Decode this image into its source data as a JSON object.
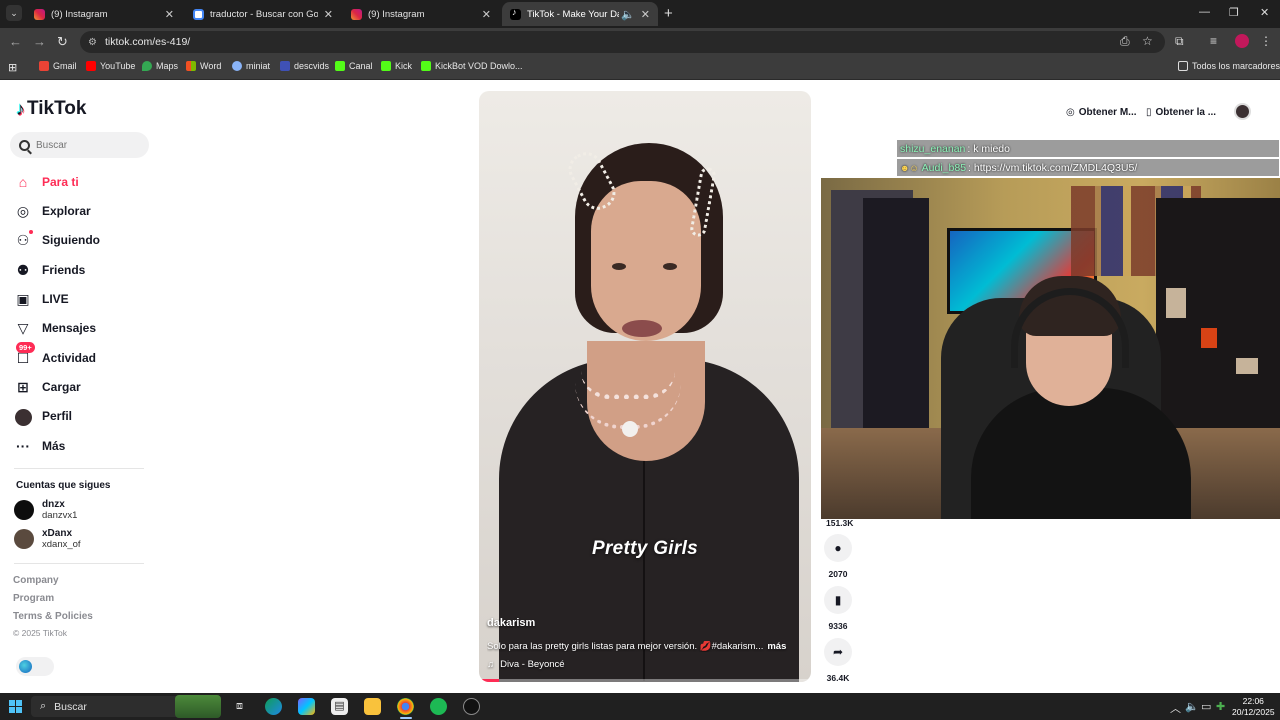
{
  "browser": {
    "tabs": [
      {
        "title": "(9) Instagram",
        "favicon": "instagram-icon",
        "active": false
      },
      {
        "title": "traductor - Buscar con Google",
        "favicon": "google-icon",
        "active": false
      },
      {
        "title": "(9) Instagram",
        "favicon": "instagram-icon",
        "active": false
      },
      {
        "title": "TikTok - Make Your Day",
        "favicon": "tiktok-icon",
        "active": true
      }
    ],
    "url": "tiktok.com/es-419/",
    "bookmarks": [
      {
        "label": "Gmail",
        "color": "#ea4335"
      },
      {
        "label": "YouTube",
        "color": "#ff0000"
      },
      {
        "label": "Maps",
        "color": "#34a853"
      },
      {
        "label": "Word",
        "color": "#2b579a"
      },
      {
        "label": "miniat",
        "color": "#8ab4f8"
      },
      {
        "label": "descvids",
        "color": "#3f51b5"
      },
      {
        "label": "Canal",
        "color": "#53fc18"
      },
      {
        "label": "Kick",
        "color": "#53fc18"
      },
      {
        "label": "KickBot VOD Dowlo...",
        "color": "#53fc18"
      }
    ],
    "all_bookmarks": "Todos los marcadores"
  },
  "tiktok": {
    "logo": "TikTok",
    "search_placeholder": "Buscar",
    "nav": [
      {
        "label": "Para ti",
        "icon": "home-icon",
        "active": true
      },
      {
        "label": "Explorar",
        "icon": "compass-icon"
      },
      {
        "label": "Siguiendo",
        "icon": "following-icon"
      },
      {
        "label": "Friends",
        "icon": "friends-icon"
      },
      {
        "label": "LIVE",
        "icon": "live-icon"
      },
      {
        "label": "Mensajes",
        "icon": "messages-icon"
      },
      {
        "label": "Actividad",
        "icon": "activity-icon",
        "badge": "99+"
      },
      {
        "label": "Cargar",
        "icon": "upload-icon"
      },
      {
        "label": "Perfil",
        "icon": "profile-avatar"
      },
      {
        "label": "Más",
        "icon": "more-icon"
      }
    ],
    "following_title": "Cuentas que sigues",
    "following": [
      {
        "name": "dnzx",
        "username": "danzvx1",
        "avatar_color": "#0d0d0d"
      },
      {
        "name": "xDanx",
        "username": "xdanx_of",
        "avatar_color": "#5a4a3e"
      }
    ],
    "footer": [
      "Company",
      "Program",
      "Terms & Policies"
    ],
    "copyright": "© 2025 TikTok",
    "header": {
      "get_coins": "Obtener M...",
      "get_app": "Obtener la ..."
    },
    "video": {
      "overlay_text": "Pretty Girls",
      "author": "dakarism",
      "description": "Solo para las pretty girls listas para mejor versión. 💋#dakarism...",
      "more": "más",
      "music": "Diva - Beyoncé",
      "progress": 0.06
    },
    "actions": {
      "likes": "151.3K",
      "comments": "2070",
      "saves": "9336",
      "shares": "36.4K"
    }
  },
  "stream": {
    "chat": [
      {
        "user": "shizu_enanan",
        "text": ": k miedo"
      },
      {
        "user": "Audi_b85",
        "text": ": https://vm.tiktok.com/ZMDL4Q3U5/"
      }
    ]
  },
  "taskbar": {
    "search": "Buscar",
    "time": "22:06",
    "date": "20/12/2025"
  }
}
